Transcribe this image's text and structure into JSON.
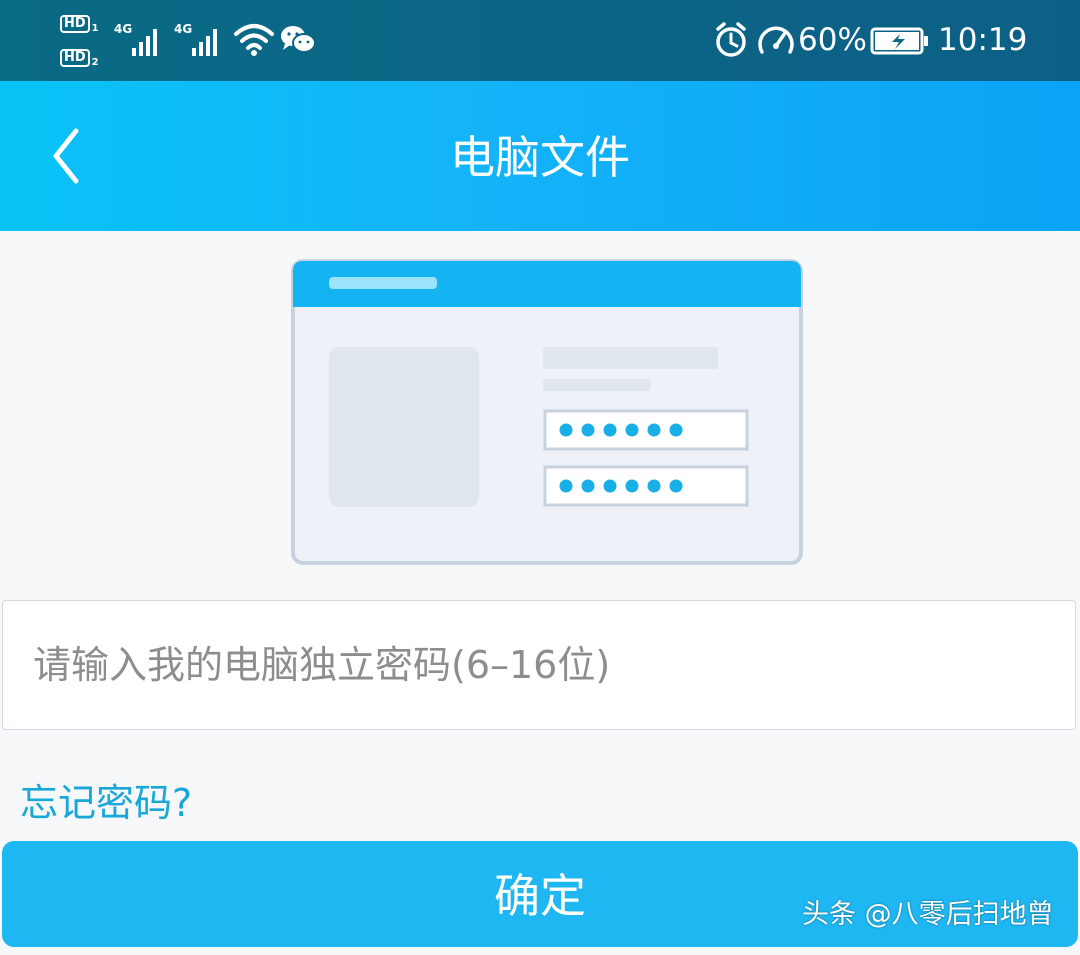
{
  "status_bar": {
    "hd1": "HD",
    "sim1": "1",
    "hd2": "HD",
    "sim2": "2",
    "net1": "4G",
    "net2": "4G",
    "battery_percent": "60%",
    "time": "10:19",
    "icons": [
      "hd-icon",
      "signal-icon",
      "wifi-icon",
      "wechat-icon",
      "alarm-icon",
      "speed-icon",
      "battery-icon"
    ]
  },
  "app_bar": {
    "title": "电脑文件",
    "back_icon": "chevron-left-icon"
  },
  "form": {
    "password_placeholder": "请输入我的电脑独立密码(6–16位)",
    "password_value": "",
    "forgot_label": "忘记密码?",
    "confirm_label": "确定"
  },
  "watermark": "头条 @八零后扫地曾",
  "colors": {
    "app_bar": "#14b3f8",
    "status_bar": "#0b6685",
    "accent": "#1fb7f2",
    "link": "#19a6d8",
    "background": "#f7f8fa"
  }
}
